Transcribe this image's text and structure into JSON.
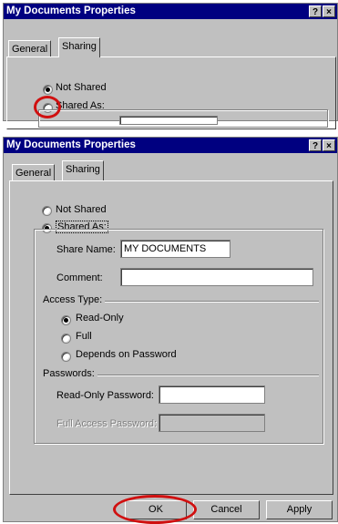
{
  "top_dialog": {
    "title": "My Documents Properties",
    "help_btn": "?",
    "close_btn": "×",
    "tabs": [
      "General",
      "Sharing"
    ],
    "not_shared": "Not Shared",
    "shared_as": "Shared As:"
  },
  "dialog": {
    "title": "My Documents Properties",
    "help_btn": "?",
    "close_btn": "×",
    "tabs": [
      "General",
      "Sharing"
    ],
    "not_shared": "Not Shared",
    "shared_as": "Shared As:",
    "share_name_label": "Share Name:",
    "share_name_value": "MY DOCUMENTS",
    "comment_label": "Comment:",
    "comment_value": "",
    "access_type_label": "Access Type:",
    "access_read_only": "Read-Only",
    "access_full": "Full",
    "access_depends": "Depends on Password",
    "passwords_label": "Passwords:",
    "read_only_password_label": "Read-Only Password:",
    "full_access_password_label": "Full Access Password:",
    "ok": "OK",
    "cancel": "Cancel",
    "apply": "Apply"
  }
}
